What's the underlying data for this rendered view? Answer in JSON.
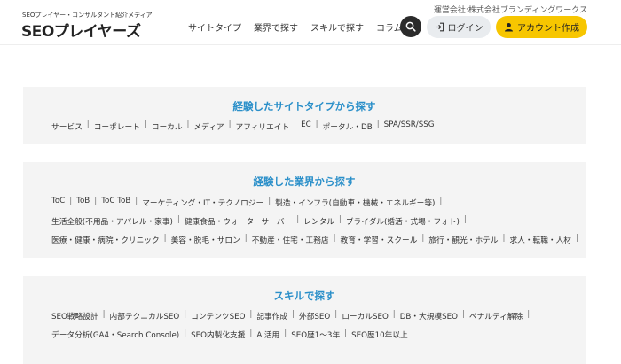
{
  "header": {
    "tagline": "SEOプレイヤー・コンサルタント紹介メディア",
    "logo": "SEOプレイヤーズ",
    "operator": "運営会社:株式会社ブランディングワークス",
    "nav": [
      "サイトタイプ",
      "業界で探す",
      "スキルで探す",
      "コラム"
    ],
    "login_label": "ログイン",
    "account_label": "アカウント作成"
  },
  "sections": [
    {
      "title": "経験したサイトタイプから探す",
      "rows": [
        [
          "サービス",
          "コーポレート",
          "ローカル",
          "メディア",
          "アフィリエイト",
          "EC",
          "ポータル・DB",
          "SPA/SSR/SSG"
        ]
      ]
    },
    {
      "title": "経験した業界から探す",
      "rows": [
        [
          "ToC",
          "ToB",
          "ToC ToB",
          "マーケティング・IT・テクノロジー",
          "製造・インフラ(自動車・機械・エネルギー等)"
        ],
        [
          "生活全般(不用品・アパレル・家事)",
          "健康食品・ウォーターサーバー",
          "レンタル",
          "ブライダル(婚活・式場・フォト)"
        ],
        [
          "医療・健康・病院・クリニック",
          "美容・脱毛・サロン",
          "不動産・住宅・工務店",
          "教育・学習・スクール",
          "旅行・観光・ホテル",
          "求人・転職・人材"
        ]
      ]
    },
    {
      "title": "スキルで探す",
      "rows": [
        [
          "SEO戦略設計",
          "内部テクニカルSEO",
          "コンテンツSEO",
          "記事作成",
          "外部SEO",
          "ローカルSEO",
          "DB・大規模SEO",
          "ペナルティ解除"
        ],
        [
          "データ分析(GA4・Search Console)",
          "SEO内製化支援",
          "AI活用",
          "SEO歴1〜3年",
          "SEO歴10年以上"
        ]
      ]
    }
  ],
  "trailing_sep_rows": [
    [
      "1.0",
      "1.1",
      "1.2"
    ],
    [
      "2.0"
    ]
  ]
}
